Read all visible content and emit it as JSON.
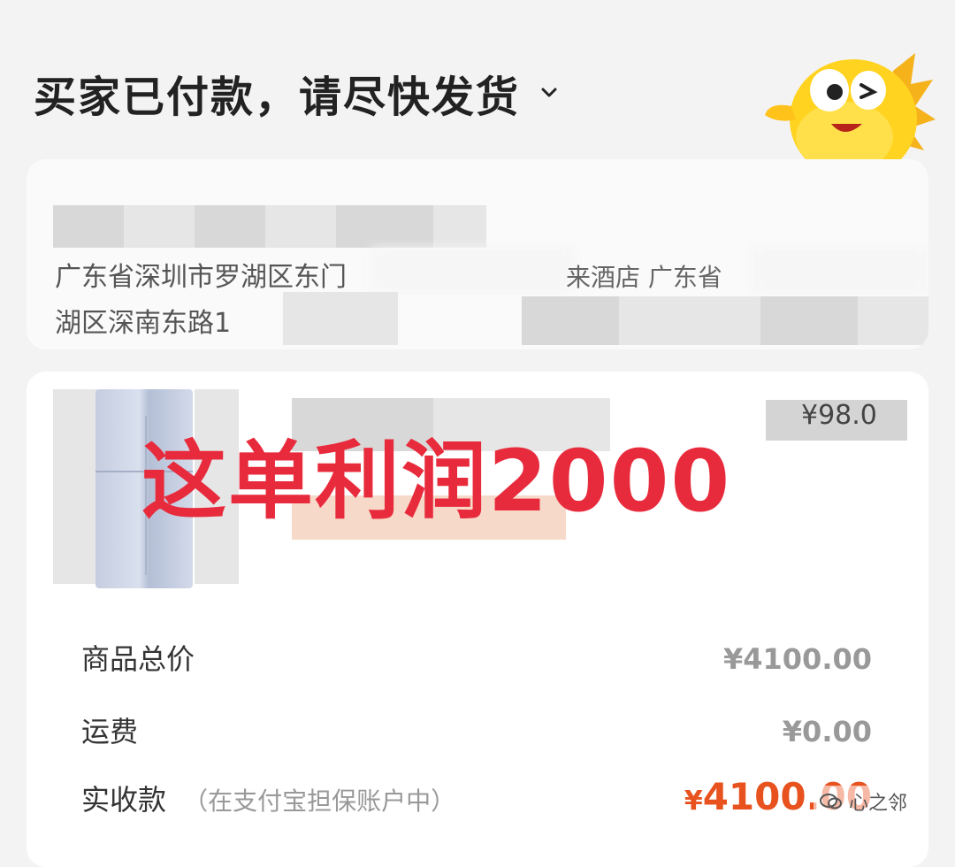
{
  "header": {
    "title": "买家已付款，请尽快发货"
  },
  "address": {
    "line1": "广东省深圳市罗湖区东门",
    "line1_tail": "来酒店 广东省",
    "line2": "湖区深南东路1"
  },
  "order": {
    "price_partial": "¥98.0"
  },
  "overlay_text": "这单利润2000",
  "summary": {
    "goods_total_label": "商品总价",
    "goods_total_value": "¥4100.00",
    "shipping_label": "运费",
    "shipping_value": "¥0.00",
    "received_label": "实收款",
    "received_note": "（在支付宝担保账户中）",
    "received_value": "4100.00",
    "currency": "¥"
  },
  "watermark": {
    "text": "心之邻"
  },
  "colors": {
    "overlay": "#e82b3c",
    "total": "#e8521e"
  }
}
